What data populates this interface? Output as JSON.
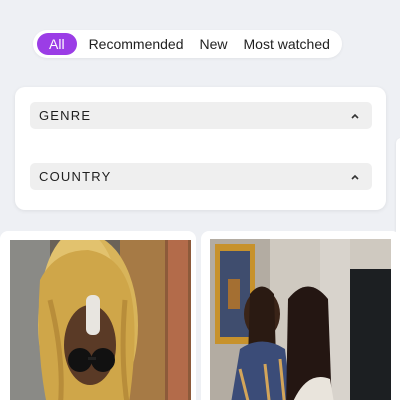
{
  "tabs": [
    {
      "label": "All",
      "active": true
    },
    {
      "label": "Recommended",
      "active": false
    },
    {
      "label": "New",
      "active": false
    },
    {
      "label": "Most watched",
      "active": false
    }
  ],
  "filters": {
    "genre_label": "GENRE",
    "country_label": "COUNTRY",
    "expand_icon": "chevron-up-icon"
  },
  "colors": {
    "accent": "#9b3de6",
    "background": "#eef0f4"
  },
  "videos": [
    {
      "thumbnail": "woman-blonde-wig-sunglasses"
    },
    {
      "thumbnail": "two-women-indoors"
    }
  ]
}
